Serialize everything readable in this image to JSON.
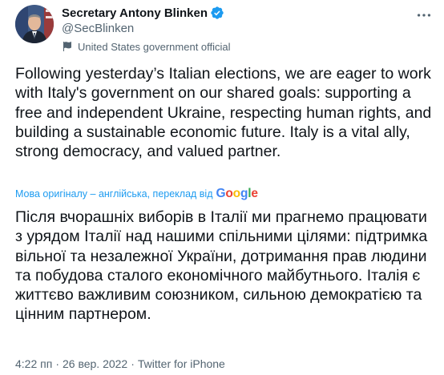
{
  "author": {
    "display_name": "Secretary Antony Blinken",
    "handle": "@SecBlinken",
    "label": "United States government official",
    "verified_icon": "verified-badge-icon",
    "label_icon": "government-flag-icon",
    "avatar": "avatar-photo"
  },
  "tweet": {
    "text": "Following yesterday’s Italian elections, we are eager to work with Italy's government on our shared goals: supporting a free and independent Ukraine, respecting human rights, and building a sustainable economic future. Italy is a vital ally, strong democracy, and valued partner.",
    "translation_note": "Мова оригіналу – англійська, переклад від",
    "translator": "Google",
    "translated_text": "Після вчорашніх виборів в Італії ми прагнемо працювати з урядом Італії над нашими спільними цілями: підтримка вільної та незалежної України, дотримання прав людини та побудова сталого економічного майбутнього. Італія є життєво важливим союзником, сильною демократією та цінним партнером.",
    "time": "4:22 пп",
    "date": "26 вер. 2022",
    "source": "Twitter for iPhone",
    "separator": "·"
  },
  "colors": {
    "accent": "#1d9bf0",
    "muted": "#536471",
    "text": "#0f1419"
  }
}
